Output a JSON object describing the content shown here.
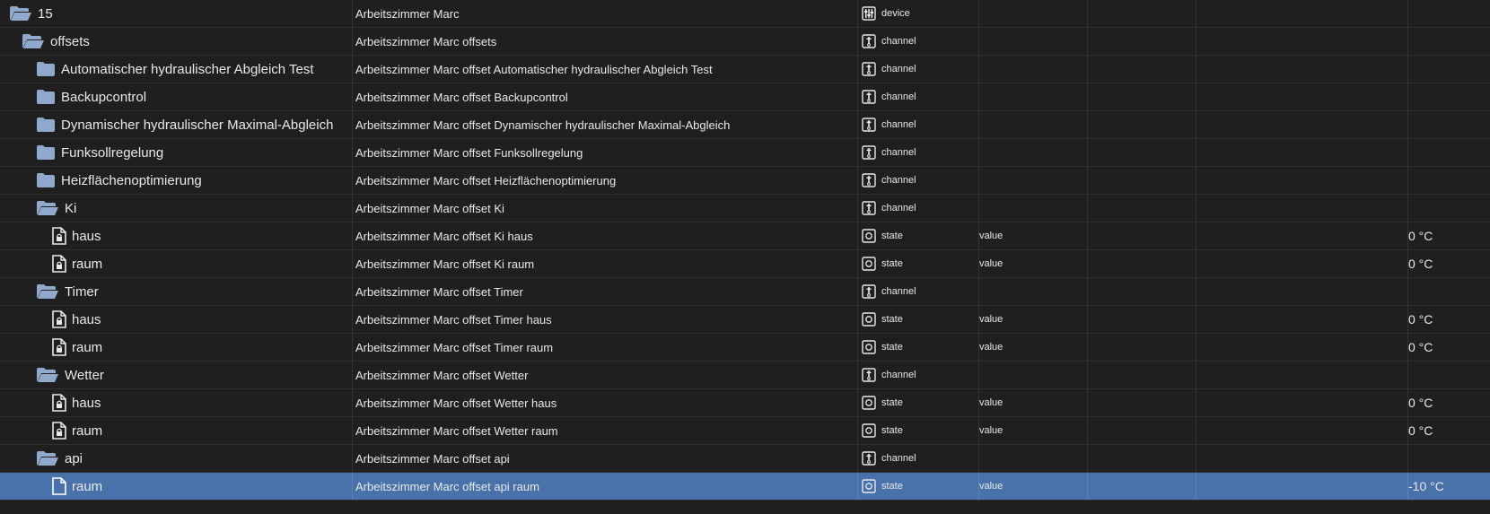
{
  "rows": [
    {
      "id": "15",
      "name": "Arbeitszimmer Marc",
      "type": "device",
      "type_icon": "device-icon",
      "id_icon": "folder-open-icon",
      "indent": 0,
      "role": "",
      "value": "",
      "selected": false
    },
    {
      "id": "offsets",
      "name": "Arbeitszimmer Marc offsets",
      "type": "channel",
      "type_icon": "channel-icon",
      "id_icon": "folder-open-icon",
      "indent": 1,
      "role": "",
      "value": "",
      "selected": false
    },
    {
      "id": "Automatischer hydraulischer Abgleich Test",
      "name": "Arbeitszimmer Marc offset Automatischer hydraulischer Abgleich Test",
      "type": "channel",
      "type_icon": "channel-icon",
      "id_icon": "folder-closed-icon",
      "indent": 2,
      "role": "",
      "value": "",
      "selected": false
    },
    {
      "id": "Backupcontrol",
      "name": "Arbeitszimmer Marc offset Backupcontrol",
      "type": "channel",
      "type_icon": "channel-icon",
      "id_icon": "folder-closed-icon",
      "indent": 2,
      "role": "",
      "value": "",
      "selected": false
    },
    {
      "id": "Dynamischer hydraulischer Maximal-Abgleich",
      "name": "Arbeitszimmer Marc offset Dynamischer hydraulischer Maximal-Abgleich",
      "type": "channel",
      "type_icon": "channel-icon",
      "id_icon": "folder-closed-icon",
      "indent": 2,
      "role": "",
      "value": "",
      "selected": false
    },
    {
      "id": "Funksollregelung",
      "name": "Arbeitszimmer Marc offset Funksollregelung",
      "type": "channel",
      "type_icon": "channel-icon",
      "id_icon": "folder-closed-icon",
      "indent": 2,
      "role": "",
      "value": "",
      "selected": false
    },
    {
      "id": "Heizflächenoptimierung",
      "name": "Arbeitszimmer Marc offset Heizflächenoptimierung",
      "type": "channel",
      "type_icon": "channel-icon",
      "id_icon": "folder-closed-icon",
      "indent": 2,
      "role": "",
      "value": "",
      "selected": false
    },
    {
      "id": "Ki",
      "name": "Arbeitszimmer Marc offset Ki",
      "type": "channel",
      "type_icon": "channel-icon",
      "id_icon": "folder-open-icon",
      "indent": 2,
      "role": "",
      "value": "",
      "selected": false
    },
    {
      "id": "haus",
      "name": "Arbeitszimmer Marc offset Ki haus",
      "type": "state",
      "type_icon": "state-icon",
      "id_icon": "file-locked-icon",
      "indent": 3,
      "role": "value",
      "value": "0 °C",
      "selected": false
    },
    {
      "id": "raum",
      "name": "Arbeitszimmer Marc offset Ki raum",
      "type": "state",
      "type_icon": "state-icon",
      "id_icon": "file-locked-icon",
      "indent": 3,
      "role": "value",
      "value": "0 °C",
      "selected": false
    },
    {
      "id": "Timer",
      "name": "Arbeitszimmer Marc offset Timer",
      "type": "channel",
      "type_icon": "channel-icon",
      "id_icon": "folder-open-icon",
      "indent": 2,
      "role": "",
      "value": "",
      "selected": false
    },
    {
      "id": "haus",
      "name": "Arbeitszimmer Marc offset Timer haus",
      "type": "state",
      "type_icon": "state-icon",
      "id_icon": "file-locked-icon",
      "indent": 3,
      "role": "value",
      "value": "0 °C",
      "selected": false
    },
    {
      "id": "raum",
      "name": "Arbeitszimmer Marc offset Timer raum",
      "type": "state",
      "type_icon": "state-icon",
      "id_icon": "file-locked-icon",
      "indent": 3,
      "role": "value",
      "value": "0 °C",
      "selected": false
    },
    {
      "id": "Wetter",
      "name": "Arbeitszimmer Marc offset Wetter",
      "type": "channel",
      "type_icon": "channel-icon",
      "id_icon": "folder-open-icon",
      "indent": 2,
      "role": "",
      "value": "",
      "selected": false
    },
    {
      "id": "haus",
      "name": "Arbeitszimmer Marc offset Wetter haus",
      "type": "state",
      "type_icon": "state-icon",
      "id_icon": "file-locked-icon",
      "indent": 3,
      "role": "value",
      "value": "0 °C",
      "selected": false
    },
    {
      "id": "raum",
      "name": "Arbeitszimmer Marc offset Wetter raum",
      "type": "state",
      "type_icon": "state-icon",
      "id_icon": "file-locked-icon",
      "indent": 3,
      "role": "value",
      "value": "0 °C",
      "selected": false
    },
    {
      "id": "api",
      "name": "Arbeitszimmer Marc offset api",
      "type": "channel",
      "type_icon": "channel-icon",
      "id_icon": "folder-open-icon",
      "indent": 2,
      "role": "",
      "value": "",
      "selected": false
    },
    {
      "id": "raum",
      "name": "Arbeitszimmer Marc offset api raum",
      "type": "state",
      "type_icon": "state-icon",
      "id_icon": "file-icon",
      "indent": 3,
      "role": "value",
      "value": "-10 °C",
      "selected": true
    }
  ],
  "colors": {
    "background": "#1f1f1f",
    "folder": "#8fa8cc",
    "selected_row": "#4a72aa",
    "text": "#e8e8e8"
  }
}
